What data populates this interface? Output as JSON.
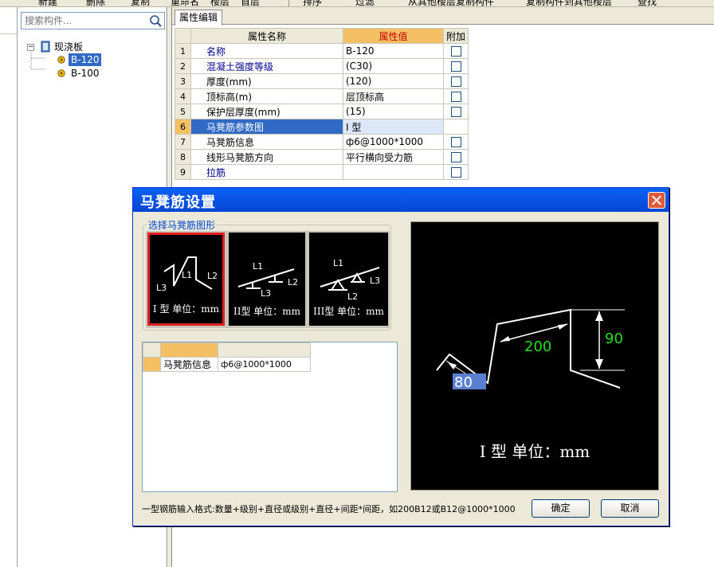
{
  "toolbar": {
    "items": [
      "新建",
      "删除",
      "复制",
      "重命名",
      "楼层",
      "首层",
      "排序",
      "过滤",
      "从其他楼层复制构件",
      "复制构件到其他楼层",
      "查找"
    ]
  },
  "tree": {
    "search_placeholder": "搜索构件...",
    "root_label": "现浇板",
    "items": [
      {
        "label": "B-120"
      },
      {
        "label": "B-100"
      }
    ]
  },
  "properties": {
    "tab": "属性编辑",
    "headers": {
      "name": "属性名称",
      "value": "属性值",
      "extra": "附加"
    },
    "rows": [
      {
        "num": "1",
        "name": "名称",
        "value": "B-120",
        "blue": true
      },
      {
        "num": "2",
        "name": "混凝土强度等级",
        "value": "(C30)",
        "blue": true
      },
      {
        "num": "3",
        "name": "厚度(mm)",
        "value": "(120)",
        "blue": false
      },
      {
        "num": "4",
        "name": "顶标高(m)",
        "value": "层顶标高",
        "blue": false
      },
      {
        "num": "5",
        "name": "保护层厚度(mm)",
        "value": "(15)",
        "blue": false
      },
      {
        "num": "6",
        "name": "马凳筋参数图",
        "value": "I 型",
        "blue": false
      },
      {
        "num": "7",
        "name": "马凳筋信息",
        "value": "ф6@1000*1000",
        "blue": false
      },
      {
        "num": "8",
        "name": "线形马凳筋方向",
        "value": "平行横向受力筋",
        "blue": false
      },
      {
        "num": "9",
        "name": "拉筋",
        "value": "",
        "blue": true
      }
    ]
  },
  "dialog": {
    "title": "马凳筋设置",
    "group_label": "选择马凳筋图形",
    "choices": [
      {
        "caption": "I 型  单位：mm",
        "l1": "L1",
        "l2": "L2",
        "l3": "L3"
      },
      {
        "caption": "II型  单位：mm",
        "l1": "L1",
        "l2": "L2",
        "l3": "L3"
      },
      {
        "caption": "III型  单位：mm",
        "l1": "L1",
        "l2": "L2",
        "l3": "L3"
      }
    ],
    "info_label": "马凳筋信息",
    "info_value": "ф6@1000*1000",
    "preview": {
      "dim_l1": "200",
      "dim_l2": "90",
      "dim_l3": "80",
      "caption": "I 型  单位：mm"
    },
    "hint": "一型钢筋输入格式:数量+级别+直径或级别+直径+间距*间距，如200B12或B12@1000*1000",
    "ok_label": "确定",
    "cancel_label": "取消"
  }
}
